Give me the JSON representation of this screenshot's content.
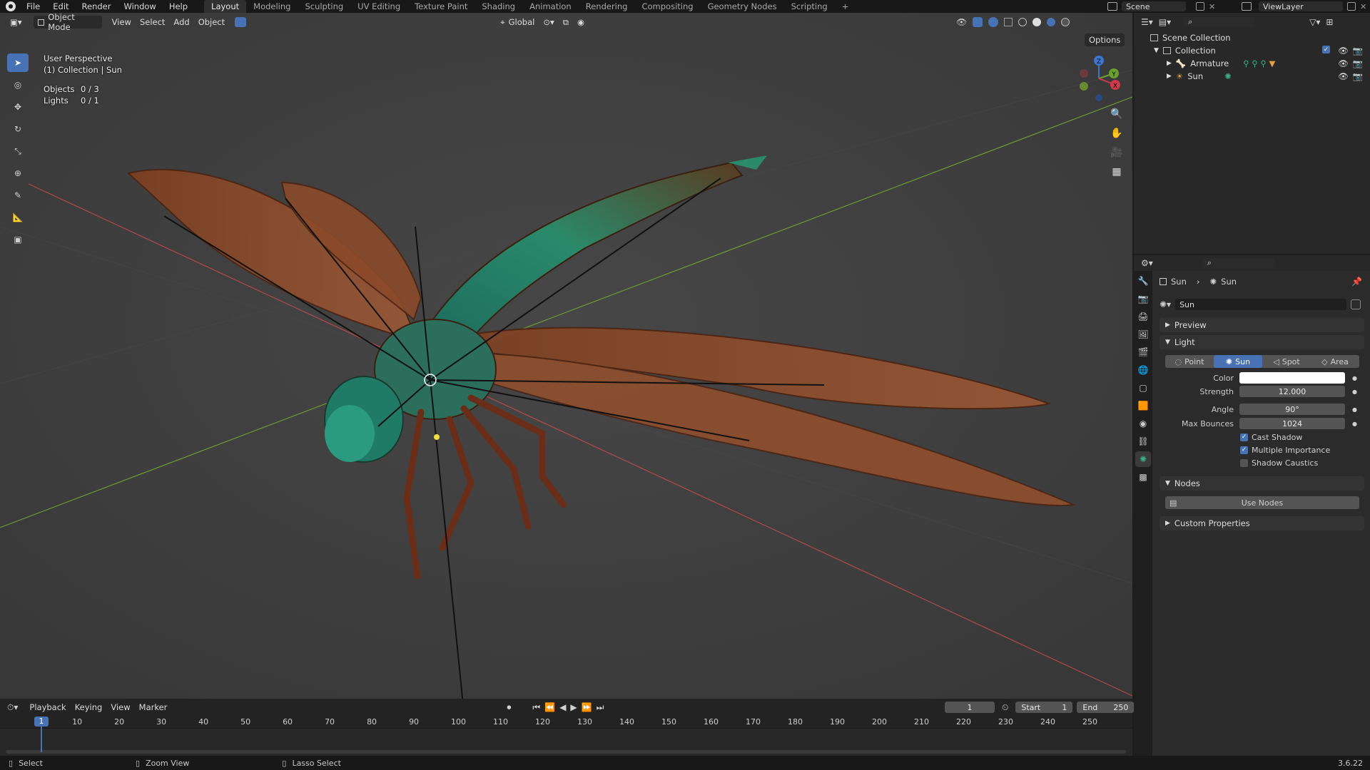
{
  "topbar": {
    "menus": [
      "File",
      "Edit",
      "Render",
      "Window",
      "Help"
    ],
    "workspaces": [
      "Layout",
      "Modeling",
      "Sculpting",
      "UV Editing",
      "Texture Paint",
      "Shading",
      "Animation",
      "Rendering",
      "Compositing",
      "Geometry Nodes",
      "Scripting"
    ],
    "add_tab": "+",
    "scene": "Scene",
    "view_layer": "ViewLayer"
  },
  "viewport_header": {
    "mode": "Object Mode",
    "menus": [
      "View",
      "Select",
      "Add",
      "Object"
    ],
    "orientation": "Global",
    "options": "Options"
  },
  "overlay": {
    "perspective": "User Perspective",
    "collection": "(1) Collection | Sun",
    "objects_label": "Objects",
    "objects_value": "0 / 3",
    "lights_label": "Lights",
    "lights_value": "0 / 1"
  },
  "gizmo": {
    "z": "Z",
    "y": "Y",
    "x": "X"
  },
  "outliner": {
    "scene_collection": "Scene Collection",
    "collection": "Collection",
    "items": [
      "Armature",
      "Sun"
    ]
  },
  "properties": {
    "breadcrumb_object": "Sun",
    "breadcrumb_data": "Sun",
    "datablock_name": "Sun",
    "panels": {
      "preview": "Preview",
      "light": "Light",
      "nodes": "Nodes",
      "custom": "Custom Properties"
    },
    "light_types": [
      "Point",
      "Sun",
      "Spot",
      "Area"
    ],
    "active_type": "Sun",
    "color_label": "Color",
    "color_value": "#ffffff",
    "strength_label": "Strength",
    "strength_value": "12.000",
    "angle_label": "Angle",
    "angle_value": "90°",
    "bounces_label": "Max Bounces",
    "bounces_value": "1024",
    "checks": [
      {
        "label": "Cast Shadow",
        "checked": true
      },
      {
        "label": "Multiple Importance",
        "checked": true
      },
      {
        "label": "Shadow Caustics",
        "checked": false
      }
    ],
    "use_nodes": "Use Nodes"
  },
  "timeline": {
    "menus": [
      "Playback",
      "Keying",
      "View",
      "Marker"
    ],
    "current_frame": "1",
    "start_label": "Start",
    "start_value": "1",
    "end_label": "End",
    "end_value": "250",
    "frames": [
      "1",
      "10",
      "20",
      "30",
      "40",
      "50",
      "60",
      "70",
      "80",
      "90",
      "100",
      "110",
      "120",
      "130",
      "140",
      "150",
      "160",
      "170",
      "180",
      "190",
      "200",
      "210",
      "220",
      "230",
      "240",
      "250"
    ]
  },
  "statusbar": {
    "select": "Select",
    "zoom": "Zoom View",
    "lasso": "Lasso Select",
    "version": "3.6.22"
  }
}
